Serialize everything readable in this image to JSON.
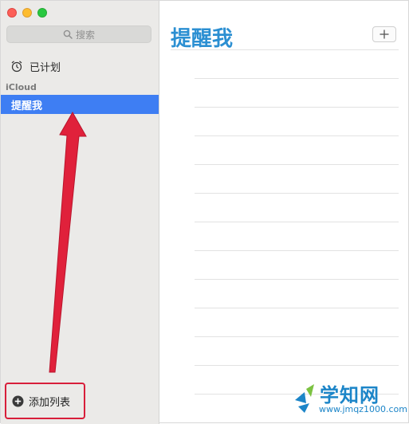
{
  "sidebar": {
    "search_placeholder": "搜索",
    "smart_list": "已计划",
    "group_label": "iCloud",
    "selected_list": "提醒我",
    "add_list_label": "添加列表"
  },
  "main": {
    "title": "提醒我"
  },
  "watermark": {
    "brand": "学知网",
    "url": "www.jmqz1000.com"
  },
  "colors": {
    "accent": "#2b8fd2",
    "selection": "#3e7ef3",
    "highlight_box": "#d81e3a",
    "arrow": "#e0213b"
  }
}
